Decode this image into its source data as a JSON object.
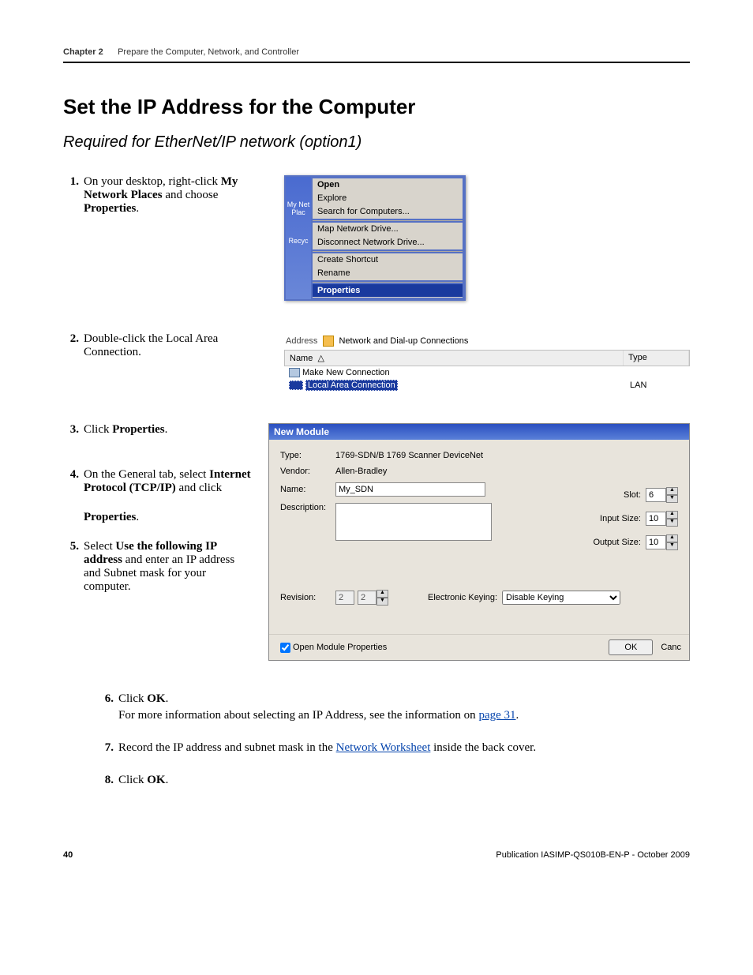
{
  "header": {
    "chapter": "Chapter 2",
    "title": "Prepare the Computer, Network, and Controller"
  },
  "h1": "Set the IP Address for the Computer",
  "subtitle": "Required for EtherNet/IP network (option1)",
  "steps": {
    "s1": {
      "num": "1.",
      "pre": "On your desktop, right-click ",
      "b1": "My Network Places",
      "mid": " and choose ",
      "b2": "Properties",
      "end": "."
    },
    "s2": {
      "num": "2.",
      "text": "Double-click the Local Area Connection."
    },
    "s3": {
      "num": "3.",
      "pre": "Click ",
      "b": "Properties",
      "end": "."
    },
    "s4": {
      "num": "4.",
      "pre": "On the General tab, select ",
      "b1": "Internet Protocol (TCP/IP)",
      "mid": " and click",
      "blank": " ",
      "b2": "Properties",
      "end": "."
    },
    "s5": {
      "num": "5.",
      "pre": "Select ",
      "b": "Use the following IP address",
      "end": " and enter an IP address and Subnet mask for your computer."
    },
    "s6": {
      "num": "6.",
      "pre": "Click ",
      "b": "OK",
      "end": ".",
      "more_pre": "For more information about selecting an IP Address, see the information on ",
      "link": "page 31",
      "more_end": "."
    },
    "s7": {
      "num": "7.",
      "pre": "Record the IP address and subnet mask in the ",
      "link": "Network Worksheet",
      "end": " inside the back cover."
    },
    "s8": {
      "num": "8.",
      "pre": "Click ",
      "b": "OK",
      "end": "."
    }
  },
  "ctx": {
    "left1": "My Net",
    "left2": "Plac",
    "left3": "Recyc",
    "items": [
      "Open",
      "Explore",
      "Search for Computers...",
      "Map Network Drive...",
      "Disconnect Network Drive...",
      "Create Shortcut",
      "Rename",
      "Properties"
    ]
  },
  "explorer": {
    "addr_label": "Address",
    "addr_value": "Network and Dial-up Connections",
    "col1": "Name",
    "col2": "Type",
    "row1": "Make New Connection",
    "row2": "Local Area Connection",
    "row2_type": "LAN"
  },
  "dialog": {
    "title": "New Module",
    "type_lbl": "Type:",
    "type_val": "1769-SDN/B 1769 Scanner DeviceNet",
    "vendor_lbl": "Vendor:",
    "vendor_val": "Allen-Bradley",
    "name_lbl": "Name:",
    "name_val": "My_SDN",
    "desc_lbl": "Description:",
    "slot_lbl": "Slot:",
    "slot_val": "6",
    "insize_lbl": "Input Size:",
    "insize_val": "10",
    "outsize_lbl": "Output Size:",
    "outsize_val": "10",
    "rev_lbl": "Revision:",
    "rev_maj": "2",
    "rev_min": "2",
    "ek_lbl": "Electronic Keying:",
    "ek_val": "Disable Keying",
    "chk_lbl": "Open Module Properties",
    "ok": "OK",
    "cancel": "Canc"
  },
  "footer": {
    "page": "40",
    "pub": "Publication IASIMP-QS010B-EN-P - October 2009"
  }
}
